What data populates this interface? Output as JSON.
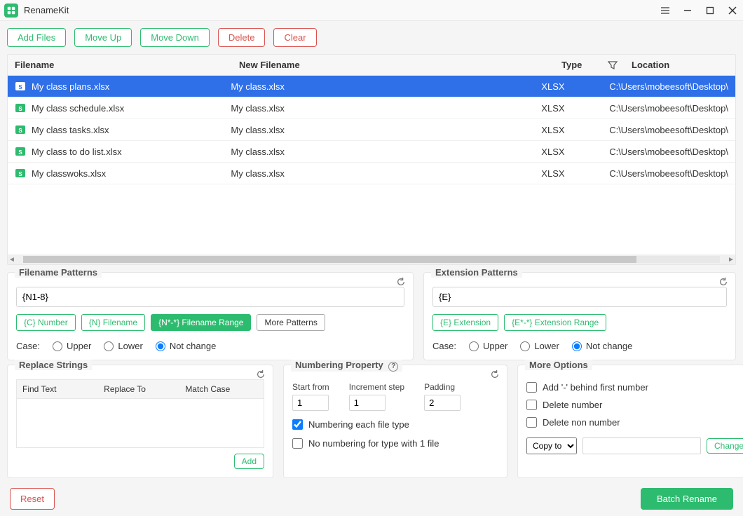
{
  "app": {
    "title": "RenameKit"
  },
  "toolbar": {
    "add_files": "Add Files",
    "move_up": "Move Up",
    "move_down": "Move Down",
    "delete": "Delete",
    "clear": "Clear"
  },
  "table": {
    "headers": {
      "filename": "Filename",
      "new_filename": "New Filename",
      "type": "Type",
      "location": "Location"
    },
    "rows": [
      {
        "filename": "My class plans.xlsx",
        "new_filename": "My class.xlsx",
        "type": "XLSX",
        "location": "C:\\Users\\mobeesoft\\Desktop\\",
        "selected": true
      },
      {
        "filename": "My class schedule.xlsx",
        "new_filename": "My class.xlsx",
        "type": "XLSX",
        "location": "C:\\Users\\mobeesoft\\Desktop\\",
        "selected": false
      },
      {
        "filename": "My class tasks.xlsx",
        "new_filename": "My class.xlsx",
        "type": "XLSX",
        "location": "C:\\Users\\mobeesoft\\Desktop\\",
        "selected": false
      },
      {
        "filename": "My class to do list.xlsx",
        "new_filename": "My class.xlsx",
        "type": "XLSX",
        "location": "C:\\Users\\mobeesoft\\Desktop\\",
        "selected": false
      },
      {
        "filename": "My classwoks.xlsx",
        "new_filename": "My class.xlsx",
        "type": "XLSX",
        "location": "C:\\Users\\mobeesoft\\Desktop\\",
        "selected": false
      }
    ]
  },
  "filename_patterns": {
    "title": "Filename Patterns",
    "value": "{N1-8}",
    "chips": {
      "c_number": "{C} Number",
      "n_filename": "{N} Filename",
      "n_range": "{N*-*} Filename Range",
      "more": "More Patterns"
    },
    "case_label": "Case:",
    "case": {
      "upper": "Upper",
      "lower": "Lower",
      "not_change": "Not change",
      "selected": "not_change"
    }
  },
  "extension_patterns": {
    "title": "Extension Patterns",
    "value": "{E}",
    "chips": {
      "e_ext": "{E} Extension",
      "e_range": "{E*-*} Extension Range"
    },
    "case_label": "Case:",
    "case": {
      "upper": "Upper",
      "lower": "Lower",
      "not_change": "Not change",
      "selected": "not_change"
    }
  },
  "replace": {
    "title": "Replace Strings",
    "headers": {
      "find": "Find Text",
      "replace": "Replace To",
      "match": "Match Case"
    },
    "add_label": "Add"
  },
  "numbering": {
    "title": "Numbering Property",
    "start_label": "Start from",
    "start_value": "1",
    "step_label": "Increment step",
    "step_value": "1",
    "pad_label": "Padding",
    "pad_value": "2",
    "each_type_label": "Numbering each file type",
    "each_type_checked": true,
    "no_numbering_label": "No numbering for type with 1 file",
    "no_numbering_checked": false
  },
  "more": {
    "title": "More Options",
    "dash_label": "Add '-' behind first number",
    "del_num_label": "Delete number",
    "del_non_num_label": "Delete non number",
    "copy_to_label": "Copy to",
    "change_label": "Change"
  },
  "footer": {
    "reset": "Reset",
    "batch_rename": "Batch Rename"
  }
}
